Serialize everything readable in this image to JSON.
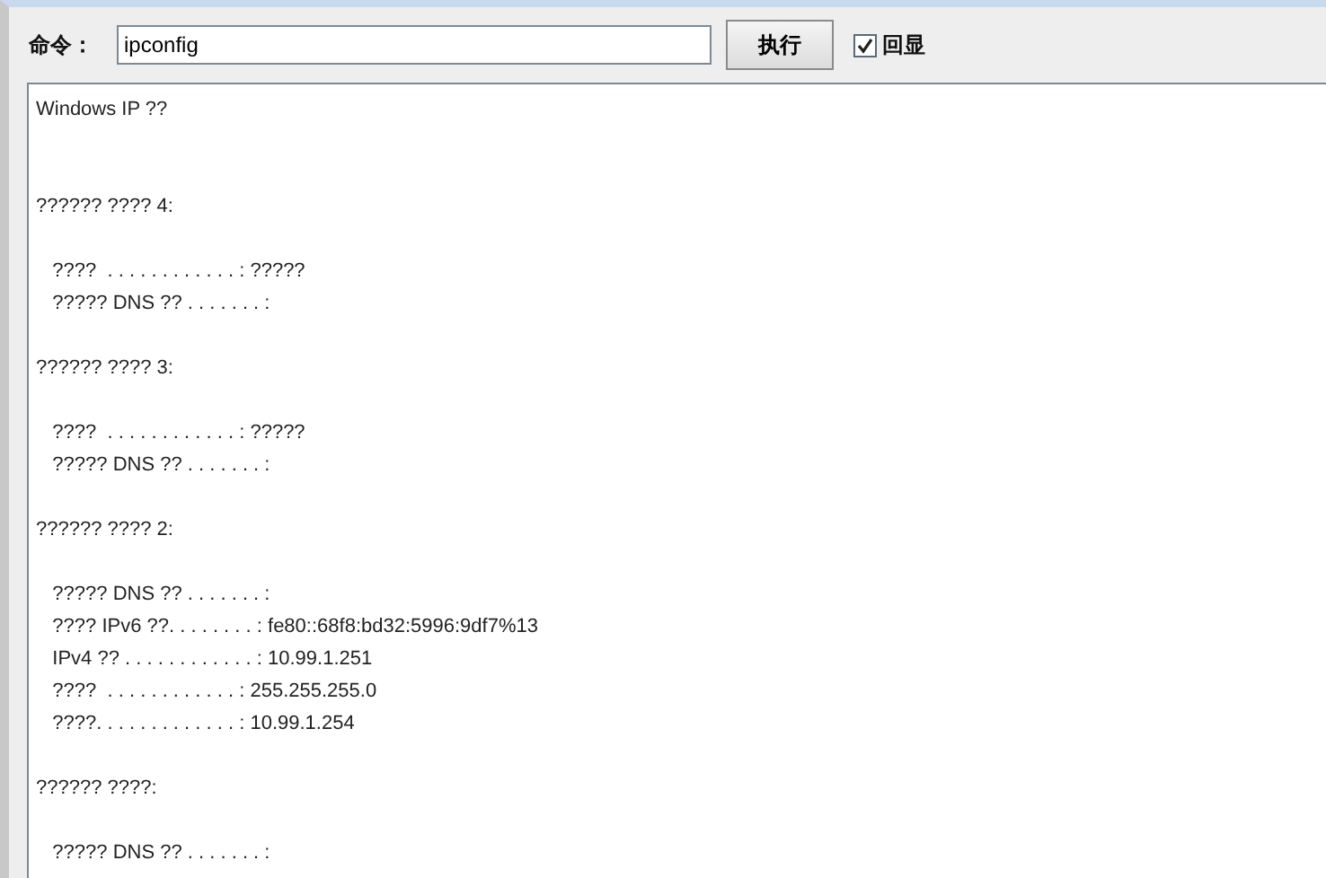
{
  "command_bar": {
    "label": "命令：",
    "command": {
      "value": "ipconfig"
    },
    "run_button": "执行",
    "echo": {
      "label": "回显",
      "checked": true
    }
  },
  "output": "Windows IP ??\n\n\n?????? ???? 4:\n\n   ????  . . . . . . . . . . . . : ?????\n   ????? DNS ?? . . . . . . . :\n\n?????? ???? 3:\n\n   ????  . . . . . . . . . . . . : ?????\n   ????? DNS ?? . . . . . . . :\n\n?????? ???? 2:\n\n   ????? DNS ?? . . . . . . . :\n   ???? IPv6 ??. . . . . . . . : fe80::68f8:bd32:5996:9df7%13\n   IPv4 ?? . . . . . . . . . . . . : 10.99.1.251\n   ????  . . . . . . . . . . . . : 255.255.255.0\n   ????. . . . . . . . . . . . . : 10.99.1.254\n\n?????? ????:\n\n   ????? DNS ?? . . . . . . . :"
}
